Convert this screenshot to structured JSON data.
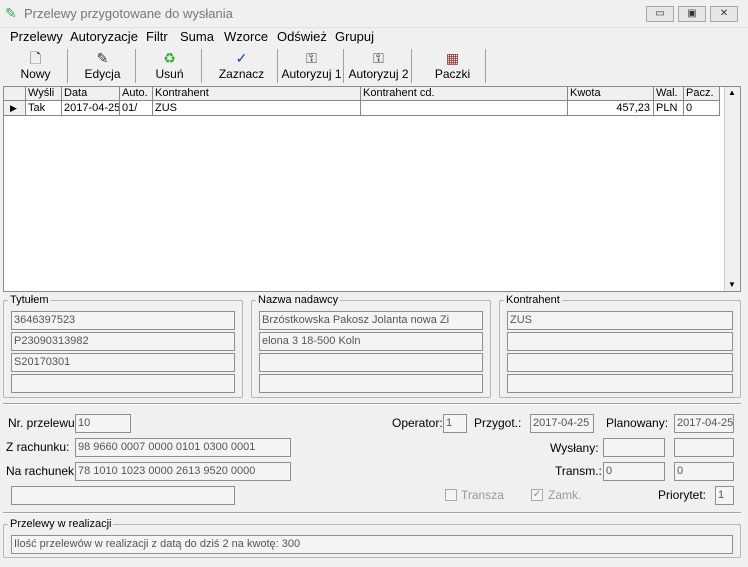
{
  "window": {
    "title": "Przelewy przygotowane do wysłania"
  },
  "menu": [
    "Przelewy",
    "Autoryzacje",
    "Filtr",
    "Suma",
    "Wzorce",
    "Odśwież",
    "Grupuj"
  ],
  "toolbar": {
    "nowy": "Nowy",
    "edycja": "Edycja",
    "usun": "Usuń",
    "zaznacz": "Zaznacz",
    "autoryzuj1": "Autoryzuj 1",
    "autoryzuj2": "Autoryzuj 2",
    "paczki": "Paczki"
  },
  "grid": {
    "headers": [
      "Wyśli",
      "Data",
      "Auto.",
      "Kontrahent",
      "Kontrahent cd.",
      "Kwota",
      "Wal.",
      "Pacz."
    ],
    "row": [
      "Tak",
      "2017-04-25",
      "01/",
      "ZUS",
      "",
      "457,23",
      "PLN",
      "0"
    ]
  },
  "tytulem": {
    "legend": "Tytułem",
    "lines": [
      "3646397523",
      "P23090313982",
      "S20170301",
      ""
    ]
  },
  "nadawca": {
    "legend": "Nazwa nadawcy",
    "lines": [
      "Brzóstkowska Pakosz Jolanta nowa Zi",
      "elona 3 18-500 Koln",
      "",
      ""
    ]
  },
  "kontrahent": {
    "legend": "Kontrahent",
    "lines": [
      "ZUS",
      "",
      "",
      ""
    ]
  },
  "details": {
    "nr_label": "Nr. przelewu:",
    "nr_value": "10",
    "z_label": "Z rachunku:",
    "z_value": "98 9660 0007 0000 0101 0300 0001",
    "na_label": "Na rachunek:",
    "na_value": "78 1010 1023 0000 2613 9520 0000",
    "extra_value": "",
    "operator_label": "Operator:",
    "operator_value": "1",
    "przygot_label": "Przygot.:",
    "przygot_value": "2017-04-25",
    "planowany_label": "Planowany:",
    "planowany_value": "2017-04-25",
    "wyslany_label": "Wysłany:",
    "wyslany_value1": "",
    "wyslany_value2": "",
    "transm_label": "Transm.:",
    "transm_value1": "0",
    "transm_value2": "0",
    "transza_label": "Transza",
    "zamk_label": "Zamk.",
    "priorytet_label": "Priorytet:",
    "priorytet_value": "1"
  },
  "realizacja": {
    "legend": "Przelewy w realizacji",
    "text": "Ilość przelewów w realizacji z datą do dziś 2 na kwotę: 300"
  }
}
